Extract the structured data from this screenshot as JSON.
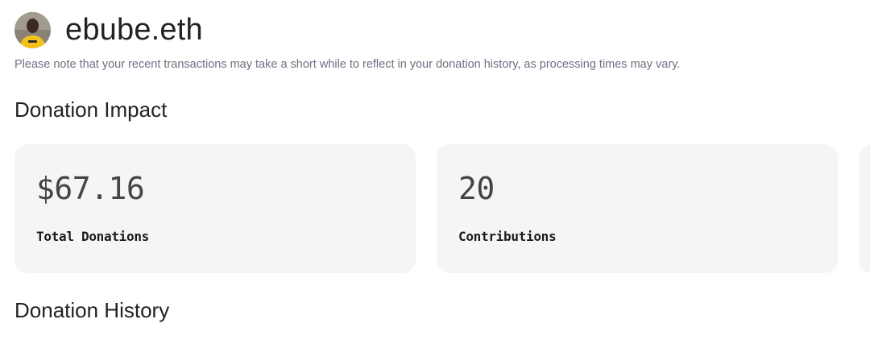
{
  "profile": {
    "username": "ebube.eth",
    "avatar_icon": "user-avatar"
  },
  "notice": "Please note that your recent transactions may take a short while to reflect in your donation history, as processing times may vary.",
  "impact": {
    "title": "Donation Impact",
    "cards": [
      {
        "value": "$67.16",
        "label": "Total Donations"
      },
      {
        "value": "20",
        "label": "Contributions"
      }
    ]
  },
  "history": {
    "title": "Donation History"
  }
}
